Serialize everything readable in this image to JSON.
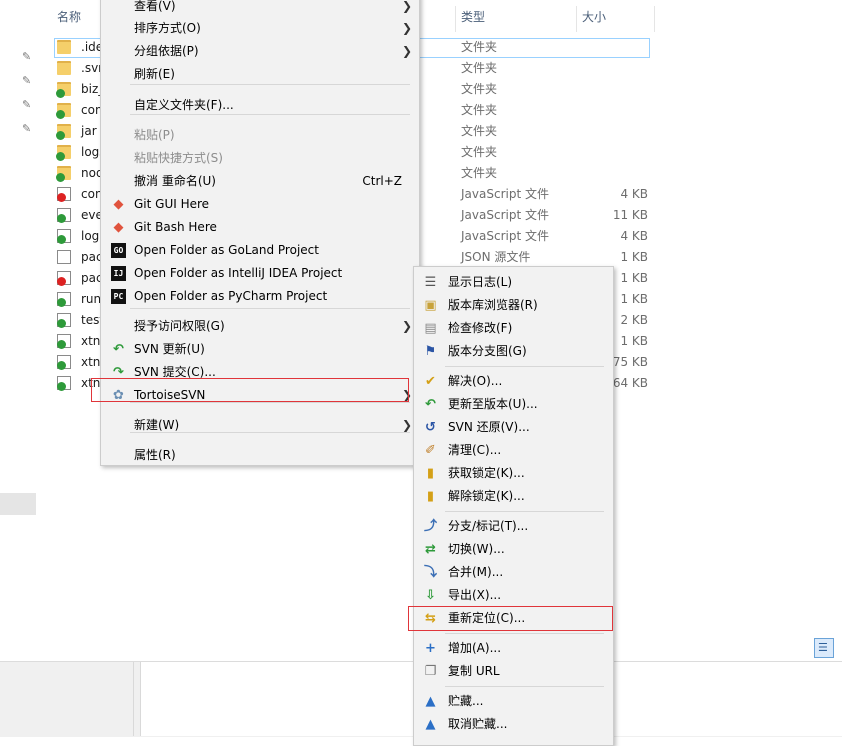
{
  "explorer": {
    "columns": {
      "name": "名称",
      "type": "类型",
      "size": "大小"
    },
    "files": [
      {
        "name": ".ide",
        "type": "文件夹",
        "size": "",
        "icon": "folder-icon",
        "badge": "none"
      },
      {
        "name": ".svn",
        "type": "文件夹",
        "size": "",
        "icon": "folder-icon",
        "badge": "none"
      },
      {
        "name": "biz_",
        "type": "文件夹",
        "size": "",
        "icon": "folder-icon",
        "badge": "ok"
      },
      {
        "name": "com",
        "type": "文件夹",
        "size": "",
        "icon": "folder-icon",
        "badge": "ok"
      },
      {
        "name": "jar",
        "type": "文件夹",
        "size": "",
        "icon": "folder-icon",
        "badge": "ok"
      },
      {
        "name": "logs",
        "type": "文件夹",
        "size": "",
        "icon": "folder-icon",
        "badge": "ok"
      },
      {
        "name": "nod",
        "type": "文件夹",
        "size": "",
        "icon": "folder-icon",
        "badge": "ok"
      },
      {
        "name": "con",
        "type": "JavaScript 文件",
        "size": "4 KB",
        "icon": "js-file-icon",
        "badge": "error"
      },
      {
        "name": "ever",
        "type": "JavaScript 文件",
        "size": "11 KB",
        "icon": "js-file-icon",
        "badge": "ok"
      },
      {
        "name": "log.",
        "type": "JavaScript 文件",
        "size": "4 KB",
        "icon": "js-file-icon",
        "badge": "ok"
      },
      {
        "name": "pac",
        "type": "JSON 源文件",
        "size": "1 KB",
        "icon": "json-file-icon",
        "badge": "none"
      },
      {
        "name": "pac",
        "type": "",
        "size": "1 KB",
        "icon": "json-file-icon",
        "badge": "error"
      },
      {
        "name": "run.",
        "type": "",
        "size": "1 KB",
        "icon": "js-file-icon",
        "badge": "ok"
      },
      {
        "name": "test",
        "type": "",
        "size": "2 KB",
        "icon": "js-file-icon",
        "badge": "ok"
      },
      {
        "name": "xtnt",
        "type": "",
        "size": "1 KB",
        "icon": "js-file-icon",
        "badge": "ok"
      },
      {
        "name": "xtnt",
        "type": "",
        "size": "75 KB",
        "icon": "js-file-icon",
        "badge": "ok"
      },
      {
        "name": "xtnt",
        "type": "",
        "size": "64 KB",
        "icon": "js-file-icon",
        "badge": "ok"
      }
    ]
  },
  "context_menu": {
    "items": [
      {
        "label": "查看(V)",
        "submenu": true
      },
      {
        "label": "排序方式(O)",
        "submenu": true
      },
      {
        "label": "分组依据(P)",
        "submenu": true
      },
      {
        "label": "刷新(E)"
      },
      {
        "label": "自定义文件夹(F)..."
      },
      {
        "label": "粘贴(P)",
        "disabled": true
      },
      {
        "label": "粘贴快捷方式(S)",
        "disabled": true
      },
      {
        "label": "撤消 重命名(U)",
        "shortcut": "Ctrl+Z"
      },
      {
        "label": "Git GUI Here",
        "icon": "git-gui-icon"
      },
      {
        "label": "Git Bash Here",
        "icon": "git-bash-icon"
      },
      {
        "label": "Open Folder as GoLand Project",
        "icon": "goland-icon",
        "icon_text": "GO"
      },
      {
        "label": "Open Folder as IntelliJ IDEA Project",
        "icon": "intellij-icon",
        "icon_text": "IJ"
      },
      {
        "label": "Open Folder as PyCharm Project",
        "icon": "pycharm-icon",
        "icon_text": "PC"
      },
      {
        "label": "授予访问权限(G)",
        "submenu": true
      },
      {
        "label": "SVN 更新(U)",
        "icon": "svn-update-icon"
      },
      {
        "label": "SVN 提交(C)...",
        "icon": "svn-commit-icon"
      },
      {
        "label": "TortoiseSVN",
        "icon": "tortoise-icon",
        "submenu": true
      },
      {
        "label": "新建(W)",
        "submenu": true
      },
      {
        "label": "属性(R)"
      }
    ]
  },
  "tortoise_menu": {
    "items": [
      {
        "label": "显示日志(L)",
        "icon": "show-log-icon"
      },
      {
        "label": "版本库浏览器(R)",
        "icon": "repo-browser-icon"
      },
      {
        "label": "检查修改(F)",
        "icon": "check-modifications-icon"
      },
      {
        "label": "版本分支图(G)",
        "icon": "revision-graph-icon"
      },
      {
        "label": "解决(O)...",
        "icon": "resolve-icon"
      },
      {
        "label": "更新至版本(U)...",
        "icon": "update-to-revision-icon"
      },
      {
        "label": "SVN 还原(V)...",
        "icon": "revert-icon"
      },
      {
        "label": "清理(C)...",
        "icon": "cleanup-icon"
      },
      {
        "label": "获取锁定(K)...",
        "icon": "get-lock-icon"
      },
      {
        "label": "解除锁定(K)...",
        "icon": "release-lock-icon"
      },
      {
        "label": "分支/标记(T)...",
        "icon": "branch-tag-icon"
      },
      {
        "label": "切换(W)...",
        "icon": "switch-icon"
      },
      {
        "label": "合并(M)...",
        "icon": "merge-icon"
      },
      {
        "label": "导出(X)...",
        "icon": "export-icon"
      },
      {
        "label": "重新定位(C)...",
        "icon": "relocate-icon"
      },
      {
        "label": "增加(A)...",
        "icon": "add-icon"
      },
      {
        "label": "复制 URL",
        "icon": "copy-url-icon"
      },
      {
        "label": "贮藏...",
        "icon": "shelve-icon"
      },
      {
        "label": "取消贮藏...",
        "icon": "unshelve-icon"
      }
    ]
  },
  "colors": {
    "highlight_border": "#e0353a",
    "menu_bg": "#f2f2f2",
    "folder": "#f5cf6a",
    "svn_ok": "#2e9a3a",
    "svn_error": "#dd2222"
  }
}
